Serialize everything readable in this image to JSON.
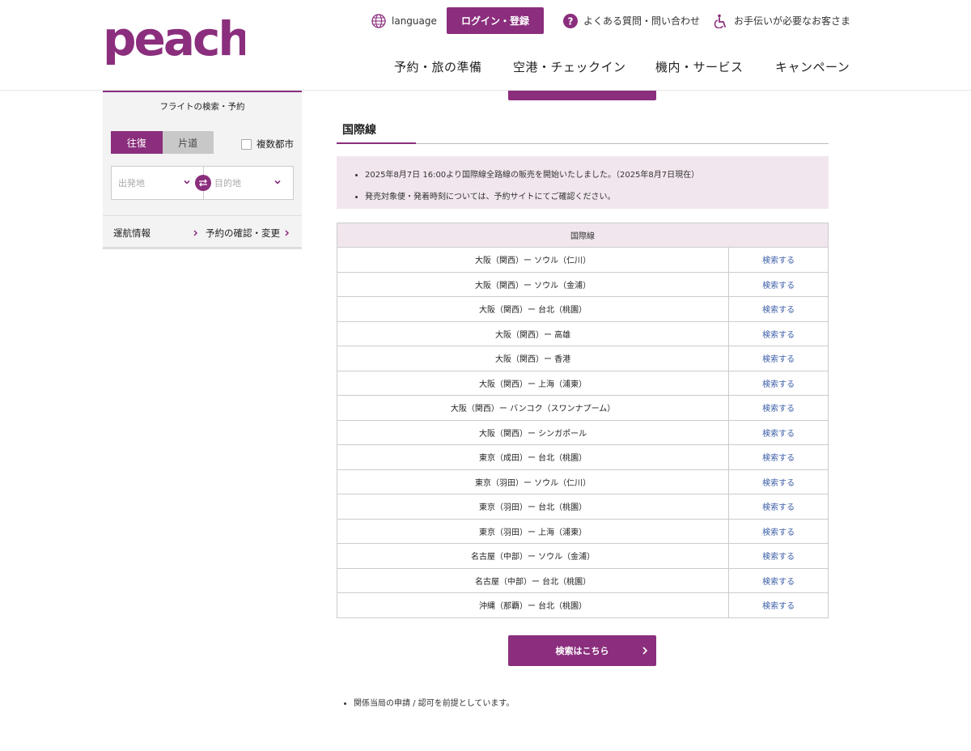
{
  "header": {
    "logo_text": "peach",
    "language_label": "language",
    "login_label": "ログイン・登録",
    "faq_label": "よくある質問・問い合わせ",
    "assist_label": "お手伝いが必要なお客さま",
    "nav": [
      "予約・旅の準備",
      "空港・チェックイン",
      "機内・サービス",
      "キャンペーン"
    ]
  },
  "sidebar": {
    "title": "フライトの検索・予約",
    "round_trip": "往復",
    "one_way": "片道",
    "multi_city": "複数都市",
    "origin_placeholder": "出発地",
    "destination_placeholder": "目的地",
    "flight_status": "運航情報",
    "manage_booking": "予約の確認・変更"
  },
  "main": {
    "tab_label": "国際線",
    "notices": [
      "2025年8月7日 16:00より国際線全路線の販売を開始いたしました。（2025年8月7日現在）",
      "発売対象便・発着時刻については、予約サイトにてご確認ください。"
    ],
    "table_header": "国際線",
    "routes": [
      {
        "route": "大阪（関西）ー ソウル（仁川）",
        "link": "検索する"
      },
      {
        "route": "大阪（関西）ー ソウル（金浦）",
        "link": "検索する"
      },
      {
        "route": "大阪（関西）ー 台北（桃園）",
        "link": "検索する"
      },
      {
        "route": "大阪（関西）ー 高雄",
        "link": "検索する"
      },
      {
        "route": "大阪（関西）ー 香港",
        "link": "検索する"
      },
      {
        "route": "大阪（関西）ー 上海（浦東）",
        "link": "検索する"
      },
      {
        "route": "大阪（関西）ー バンコク（スワンナプーム）",
        "link": "検索する"
      },
      {
        "route": "大阪（関西）ー シンガポール",
        "link": "検索する"
      },
      {
        "route": "東京（成田）ー 台北（桃園）",
        "link": "検索する"
      },
      {
        "route": "東京（羽田）ー ソウル（仁川）",
        "link": "検索する"
      },
      {
        "route": "東京（羽田）ー 台北（桃園）",
        "link": "検索する"
      },
      {
        "route": "東京（羽田）ー 上海（浦東）",
        "link": "検索する"
      },
      {
        "route": "名古屋（中部）ー ソウル（金浦）",
        "link": "検索する"
      },
      {
        "route": "名古屋（中部）ー 台北（桃園）",
        "link": "検索する"
      },
      {
        "route": "沖縄（那覇）ー 台北（桃園）",
        "link": "検索する"
      }
    ],
    "search_button": "検索はこちら",
    "footnote": "関係当局の申請 / 認可を前提としています。"
  },
  "colors": {
    "brand": "#8b2e7d",
    "notice_bg": "#f1e6ee",
    "link": "#3d5fa8"
  }
}
